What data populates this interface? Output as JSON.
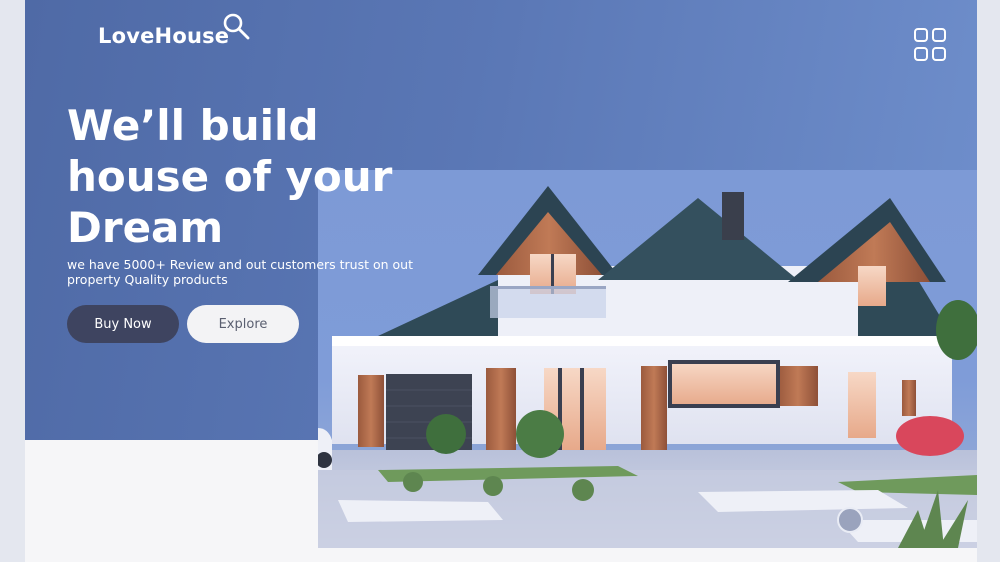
{
  "brand": {
    "name": "LoveHouse"
  },
  "icons": {
    "logo_search": "search-icon",
    "menu": "grid-menu-icon"
  },
  "hero": {
    "headline_lines": [
      "We’ll build",
      "house of your",
      "Dream"
    ],
    "subtext": "we have 5000+ Review and out customers trust on out property Quality products",
    "buttons": {
      "buy": "Buy Now",
      "explore": "Explore"
    }
  },
  "colors": {
    "hero_blue": "#5a77b5",
    "buy_button": "#3e4460",
    "explore_button": "#f3f3f5"
  }
}
